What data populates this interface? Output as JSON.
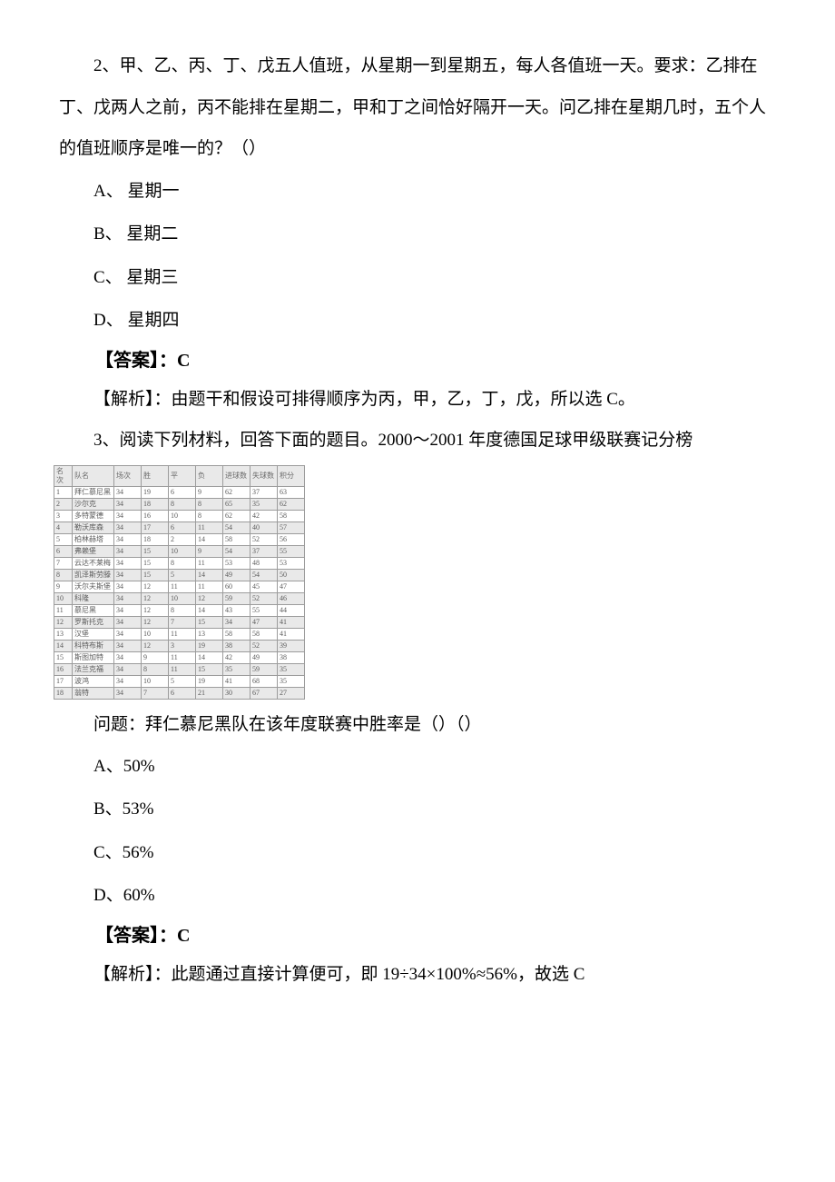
{
  "q2": {
    "stem": "2、甲、乙、丙、丁、戊五人值班，从星期一到星期五，每人各值班一天。要求：乙排在丁、戊两人之前，丙不能排在星期二，甲和丁之间恰好隔开一天。问乙排在星期几时，五个人的值班顺序是唯一的？（）",
    "A": "A、 星期一",
    "B": "B、 星期二",
    "C": "C、 星期三",
    "D": "D、 星期四",
    "ans_label": "【答案】：",
    "ans_val": "C",
    "exp": "【解析】：由题干和假设可排得顺序为丙，甲，乙，丁，戊，所以选 C。"
  },
  "q3": {
    "stem": "3、阅读下列材料，回答下面的题目。2000～2001 年度德国足球甲级联赛记分榜",
    "table_headers": [
      "名次",
      "队名",
      "场次",
      "胜",
      "平",
      "负",
      "进球数",
      "失球数",
      "积分"
    ],
    "table_rows": [
      [
        "1",
        "拜仁慕尼黑",
        "34",
        "19",
        "6",
        "9",
        "62",
        "37",
        "63"
      ],
      [
        "2",
        "沙尔克",
        "34",
        "18",
        "8",
        "8",
        "65",
        "35",
        "62"
      ],
      [
        "3",
        "多特蒙德",
        "34",
        "16",
        "10",
        "8",
        "62",
        "42",
        "58"
      ],
      [
        "4",
        "勒沃库森",
        "34",
        "17",
        "6",
        "11",
        "54",
        "40",
        "57"
      ],
      [
        "5",
        "柏林赫塔",
        "34",
        "18",
        "2",
        "14",
        "58",
        "52",
        "56"
      ],
      [
        "6",
        "弗赖堡",
        "34",
        "15",
        "10",
        "9",
        "54",
        "37",
        "55"
      ],
      [
        "7",
        "云达不莱梅",
        "34",
        "15",
        "8",
        "11",
        "53",
        "48",
        "53"
      ],
      [
        "8",
        "凯泽斯劳滕",
        "34",
        "15",
        "5",
        "14",
        "49",
        "54",
        "50"
      ],
      [
        "9",
        "沃尔夫斯堡",
        "34",
        "12",
        "11",
        "11",
        "60",
        "45",
        "47"
      ],
      [
        "10",
        "科隆",
        "34",
        "12",
        "10",
        "12",
        "59",
        "52",
        "46"
      ],
      [
        "11",
        "慕尼黑",
        "34",
        "12",
        "8",
        "14",
        "43",
        "55",
        "44"
      ],
      [
        "12",
        "罗斯托克",
        "34",
        "12",
        "7",
        "15",
        "34",
        "47",
        "41"
      ],
      [
        "13",
        "汉堡",
        "34",
        "10",
        "11",
        "13",
        "58",
        "58",
        "41"
      ],
      [
        "14",
        "科特布斯",
        "34",
        "12",
        "3",
        "19",
        "38",
        "52",
        "39"
      ],
      [
        "15",
        "斯图加特",
        "34",
        "9",
        "11",
        "14",
        "42",
        "49",
        "38"
      ],
      [
        "16",
        "法兰克福",
        "34",
        "8",
        "11",
        "15",
        "35",
        "59",
        "35"
      ],
      [
        "17",
        "波鸿",
        "34",
        "10",
        "5",
        "19",
        "41",
        "68",
        "35"
      ],
      [
        "18",
        "翁特",
        "34",
        "7",
        "6",
        "21",
        "30",
        "67",
        "27"
      ]
    ],
    "question": "问题：拜仁慕尼黑队在该年度联赛中胜率是（）（）",
    "A": "A、50%",
    "B": "B、53%",
    "C": "C、56%",
    "D": "D、60%",
    "ans_label": "【答案】：",
    "ans_val": "C",
    "exp": "【解析】：此题通过直接计算便可，即 19÷34×100%≈56%，故选 C"
  }
}
